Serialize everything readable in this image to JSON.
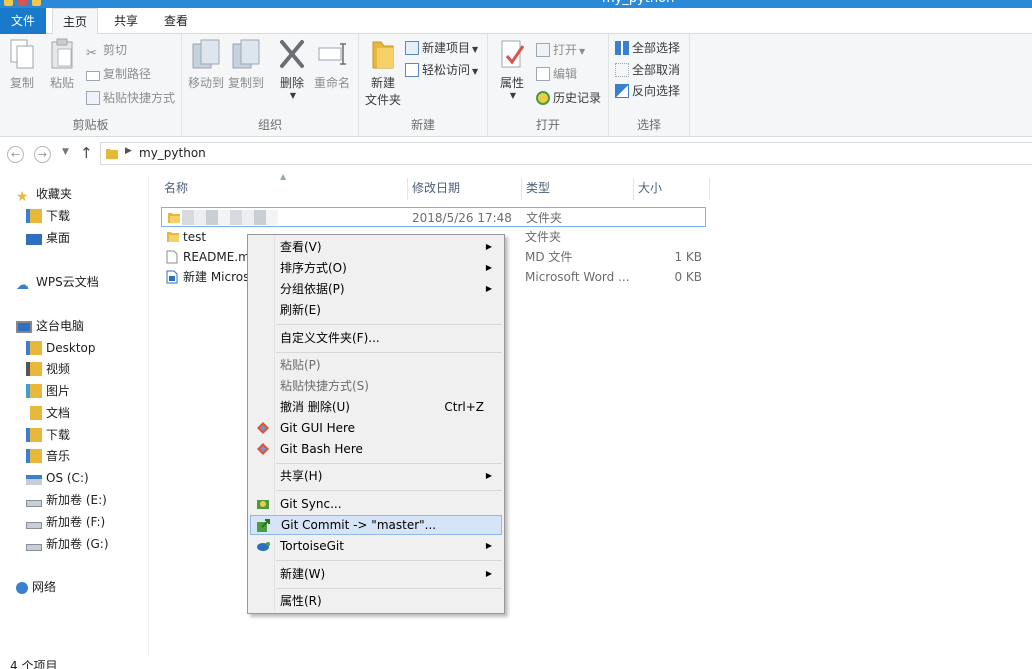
{
  "window": {
    "title": "my_python"
  },
  "ribbon": {
    "tabs": [
      {
        "label": "文件"
      },
      {
        "label": "主页"
      },
      {
        "label": "共享"
      },
      {
        "label": "查看"
      }
    ],
    "clipboard": {
      "label": "剪贴板",
      "copy": "复制",
      "paste": "粘贴",
      "cut": "剪切",
      "copy_path": "复制路径",
      "paste_shortcut": "粘贴快捷方式"
    },
    "organize": {
      "label": "组织",
      "move_to": "移动到",
      "copy_to": "复制到",
      "delete": "删除",
      "rename": "重命名"
    },
    "new": {
      "label": "新建",
      "new_folder": "新建\n文件夹",
      "new_folder_line1": "新建",
      "new_folder_line2": "文件夹",
      "new_item": "新建项目",
      "easy_access": "轻松访问"
    },
    "open": {
      "label": "打开",
      "properties": "属性",
      "open": "打开",
      "edit": "编辑",
      "history": "历史记录"
    },
    "select": {
      "label": "选择",
      "select_all": "全部选择",
      "select_none": "全部取消",
      "invert": "反向选择"
    }
  },
  "address": {
    "path": "my_python"
  },
  "nav": {
    "items": [
      {
        "label": "收藏夹",
        "icon": "star-icon"
      },
      {
        "label": "下载",
        "icon": "download-folder-icon"
      },
      {
        "label": "桌面",
        "icon": "desktop-icon"
      },
      {
        "label": "WPS云文档",
        "icon": "cloud-icon"
      },
      {
        "label": "这台电脑",
        "icon": "computer-icon"
      },
      {
        "label": "Desktop",
        "icon": "folder-icon"
      },
      {
        "label": "视频",
        "icon": "video-folder-icon"
      },
      {
        "label": "图片",
        "icon": "pictures-folder-icon"
      },
      {
        "label": "文档",
        "icon": "documents-folder-icon"
      },
      {
        "label": "下载",
        "icon": "download-folder-icon"
      },
      {
        "label": "音乐",
        "icon": "music-folder-icon"
      },
      {
        "label": "OS (C:)",
        "icon": "drive-icon"
      },
      {
        "label": "新加卷 (E:)",
        "icon": "drive-icon"
      },
      {
        "label": "新加卷 (F:)",
        "icon": "drive-icon"
      },
      {
        "label": "新加卷 (G:)",
        "icon": "drive-icon"
      },
      {
        "label": "网络",
        "icon": "network-icon"
      }
    ]
  },
  "files": {
    "columns": {
      "name": "名称",
      "date": "修改日期",
      "type": "类型",
      "size": "大小"
    },
    "rows": [
      {
        "name": "",
        "date": "2018/5/26 17:48",
        "type": "文件夹",
        "size": ""
      },
      {
        "name": "test",
        "date": "",
        "type": "文件夹",
        "size": ""
      },
      {
        "name": "README.m",
        "date": "",
        "type": "MD 文件",
        "size": "1 KB"
      },
      {
        "name": "新建 Micros",
        "date": "",
        "type": "Microsoft Word ...",
        "size": "0 KB"
      }
    ]
  },
  "status": {
    "count": "4 个项目"
  },
  "context_menu": {
    "view": "查看(V)",
    "sort": "排序方式(O)",
    "group": "分组依据(P)",
    "refresh": "刷新(E)",
    "customize": "自定义文件夹(F)...",
    "paste": "粘贴(P)",
    "paste_shortcut": "粘贴快捷方式(S)",
    "undo": "撤消 删除(U)",
    "undo_shortcut": "Ctrl+Z",
    "git_gui": "Git GUI Here",
    "git_bash": "Git Bash Here",
    "share": "共享(H)",
    "git_sync": "Git Sync...",
    "git_commit": "Git Commit -> \"master\"...",
    "tortoisegit": "TortoiseGit",
    "new": "新建(W)",
    "properties": "属性(R)"
  },
  "colors": {
    "accent": "#1979ca",
    "highlight": "#d5e5f7",
    "folder": "#e8b83c"
  }
}
